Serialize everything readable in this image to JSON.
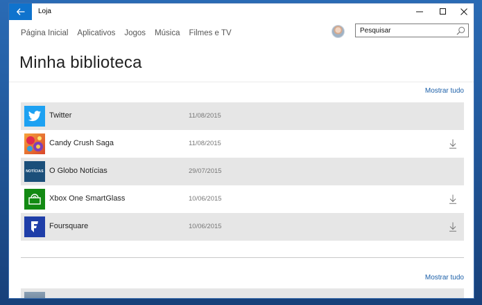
{
  "window": {
    "app_title": "Loja"
  },
  "nav": {
    "items": [
      "Página Inicial",
      "Aplicativos",
      "Jogos",
      "Música",
      "Filmes e TV"
    ]
  },
  "search": {
    "value": "Pesquisar",
    "icon": "search-icon"
  },
  "page": {
    "title": "Minha biblioteca",
    "show_all": "Mostrar tudo"
  },
  "library": [
    {
      "name": "Twitter",
      "date": "11/08/2015",
      "download": false,
      "icon": "twitter-icon",
      "color": "#1da1f2"
    },
    {
      "name": "Candy Crush Saga",
      "date": "11/08/2015",
      "download": true,
      "icon": "candy-crush-icon",
      "color": "#e8712d"
    },
    {
      "name": "O Globo Notícias",
      "date": "29/07/2015",
      "download": false,
      "icon": "oglobo-icon",
      "color": "#1b4f7a",
      "icon_text": "NOTÍCIAS"
    },
    {
      "name": "Xbox One SmartGlass",
      "date": "10/06/2015",
      "download": true,
      "icon": "xbox-smartglass-icon",
      "color": "#138a13"
    },
    {
      "name": "Foursquare",
      "date": "10/06/2015",
      "download": true,
      "icon": "foursquare-icon",
      "color": "#1f3ea8"
    }
  ],
  "section2": {
    "show_all": "Mostrar tudo"
  }
}
